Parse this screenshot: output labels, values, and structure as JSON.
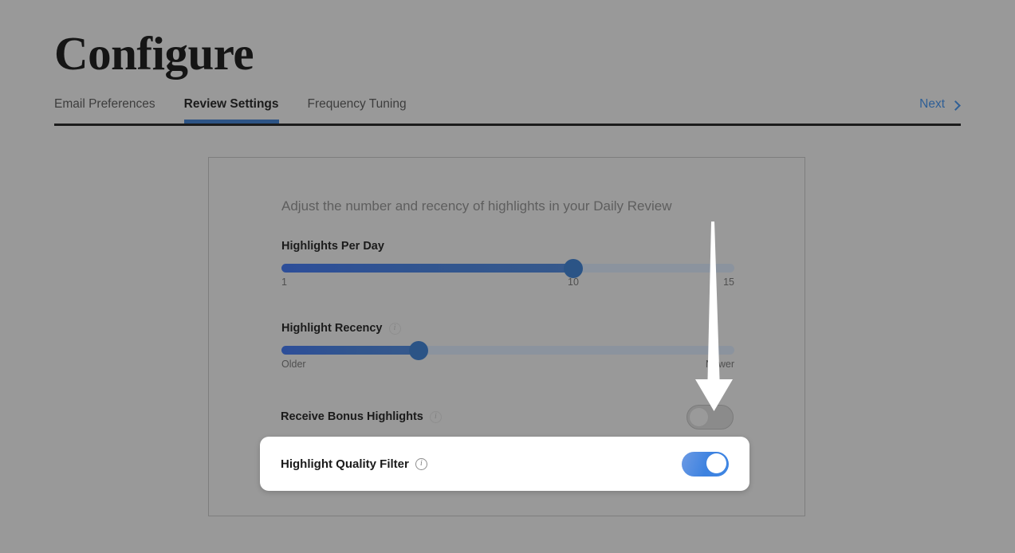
{
  "header": {
    "title": "Configure",
    "next_label": "Next",
    "next_icon": "chevron-right-icon"
  },
  "tabs": [
    {
      "label": "Email Preferences",
      "active": false
    },
    {
      "label": "Review Settings",
      "active": true
    },
    {
      "label": "Frequency Tuning",
      "active": false
    }
  ],
  "card": {
    "description": "Adjust the number and recency of highlights in your Daily Review",
    "settings": {
      "highlights_per_day": {
        "label": "Highlights Per Day",
        "min_label": "1",
        "mid_label": "10",
        "max_label": "15",
        "value": 10,
        "min": 1,
        "max": 15,
        "fill_percent": 64.4
      },
      "highlight_recency": {
        "label": "Highlight Recency",
        "info_icon": "info-icon",
        "min_label": "Older",
        "max_label": "Newer",
        "fill_percent": 30.3
      },
      "receive_bonus_highlights": {
        "label": "Receive Bonus Highlights",
        "info_icon": "info-icon",
        "state": "off"
      },
      "highlight_quality_filter": {
        "label": "Highlight Quality Filter",
        "info_icon": "info-icon",
        "state": "on"
      }
    }
  },
  "annotation": {
    "arrow": "down-arrow-annotation",
    "color": "#ffffff"
  },
  "colors": {
    "background": "#999999",
    "accent_blue": "#2d5485",
    "link_blue": "#2f5f96",
    "toggle_on": "#3d82e0",
    "slider_track": "#8b939e"
  }
}
